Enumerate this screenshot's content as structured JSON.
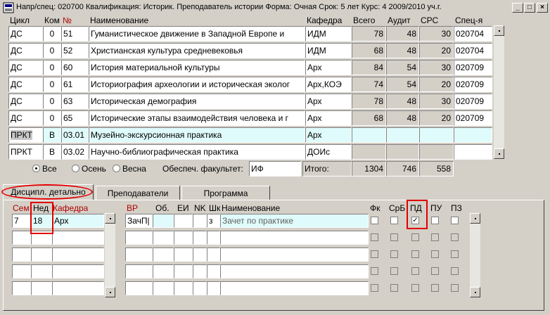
{
  "title_bar": {
    "text": "Напр/спец: 020700 Квалификация: Историк. Преподаватель истории Форма: Очная Срок: 5 лет Курс: 4 2009/2010 уч.г.",
    "minimize": "_",
    "maximize": "□",
    "close": "×"
  },
  "main_grid": {
    "headers": [
      "Цикл",
      "Ком",
      "№",
      "Наименование",
      "Кафедра",
      "Всего",
      "Аудит",
      "СРС",
      "Спец-я"
    ],
    "rows": [
      {
        "cycle": "ДС",
        "kom": "0",
        "num": "51",
        "name": "Гуманистическое движение в Западной Европе и",
        "dept": "ИДМ",
        "total": "78",
        "aud": "48",
        "srs": "30",
        "spec": "020704"
      },
      {
        "cycle": "ДС",
        "kom": "0",
        "num": "52",
        "name": "Христианская культура средневековья",
        "dept": "ИДМ",
        "total": "68",
        "aud": "48",
        "srs": "20",
        "spec": "020704"
      },
      {
        "cycle": "ДС",
        "kom": "0",
        "num": "60",
        "name": "История материальной культуры",
        "dept": "Арх",
        "total": "84",
        "aud": "54",
        "srs": "30",
        "spec": "020709"
      },
      {
        "cycle": "ДС",
        "kom": "0",
        "num": "61",
        "name": "Историография археологии и историческая эколог",
        "dept": "Арх,КОЭ",
        "total": "74",
        "aud": "54",
        "srs": "20",
        "spec": "020709"
      },
      {
        "cycle": "ДС",
        "kom": "0",
        "num": "63",
        "name": "Историческая демография",
        "dept": "Арх",
        "total": "78",
        "aud": "48",
        "srs": "30",
        "spec": "020709"
      },
      {
        "cycle": "ДС",
        "kom": "0",
        "num": "65",
        "name": "Исторические этапы взаимодействия человека и г",
        "dept": "Арх",
        "total": "68",
        "aud": "48",
        "srs": "20",
        "spec": "020709"
      },
      {
        "cycle": "ПРКТ",
        "kom": "В",
        "num": "03.01",
        "name": "Музейно-экскурсионная практика",
        "dept": "Арх",
        "total": "",
        "aud": "",
        "srs": "",
        "spec": ""
      },
      {
        "cycle": "ПРКТ",
        "kom": "В",
        "num": "03.02",
        "name": "Научно-библиографическая практика",
        "dept": "ДОИс",
        "total": "",
        "aud": "",
        "srs": "",
        "spec": ""
      }
    ]
  },
  "filter": {
    "options": [
      "Все",
      "Осень",
      "Весна"
    ],
    "selected": "Все",
    "faculty_label": "Обеспеч. факультет:",
    "faculty_value": "ИФ",
    "total_label": "Итого:",
    "total_all": "1304",
    "total_aud": "746",
    "total_srs": "558"
  },
  "tabs": [
    "Дисципл. детально",
    "Преподаватели",
    "Программа"
  ],
  "active_tab": "Дисципл. детально",
  "left_detail": {
    "headers": [
      "Сем",
      "Нед",
      "Кафедра"
    ],
    "rows": [
      {
        "sem": "7",
        "ned": "18",
        "dept": "Арх"
      },
      {
        "sem": "",
        "ned": "",
        "dept": ""
      },
      {
        "sem": "",
        "ned": "",
        "dept": ""
      },
      {
        "sem": "",
        "ned": "",
        "dept": ""
      },
      {
        "sem": "",
        "ned": "",
        "dept": ""
      }
    ]
  },
  "right_detail": {
    "headers": [
      "ВР",
      "Об.",
      "ЕИ",
      "NK",
      "Шк",
      "Наименование",
      "Фк",
      "СрБ",
      "ПД",
      "ПУ",
      "ПЗ"
    ],
    "rows": [
      {
        "vr": "ЗачП|",
        "ob": "",
        "ei": "",
        "nk": "",
        "shk": "з",
        "name": "Зачет по практике",
        "pd_checked": true
      },
      {
        "vr": "",
        "ob": "",
        "ei": "",
        "nk": "",
        "shk": "",
        "name": "",
        "pd_checked": false
      },
      {
        "vr": "",
        "ob": "",
        "ei": "",
        "nk": "",
        "shk": "",
        "name": "",
        "pd_checked": false
      },
      {
        "vr": "",
        "ob": "",
        "ei": "",
        "nk": "",
        "shk": "",
        "name": "",
        "pd_checked": false
      },
      {
        "vr": "",
        "ob": "",
        "ei": "",
        "nk": "",
        "shk": "",
        "name": "",
        "pd_checked": false
      }
    ],
    "check_mark": "✓"
  },
  "colors": {
    "window_bg": "#d4d0c8",
    "selected_row": "#e0fbfb",
    "annotation": "#e00000",
    "header_red": "#b00000"
  }
}
